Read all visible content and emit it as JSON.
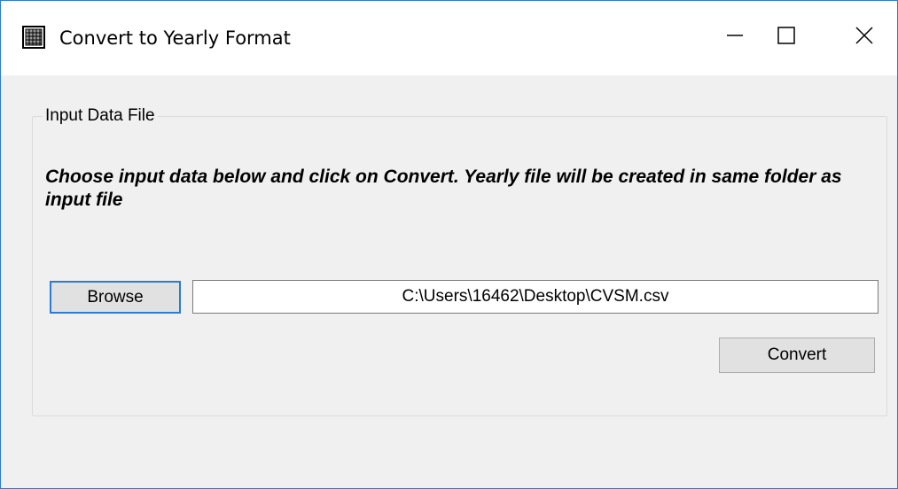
{
  "window": {
    "title": "Convert to Yearly Format",
    "icon": "table-grid-icon",
    "border_color": "#2b7cd3",
    "background": "#f0f0f0"
  },
  "titlebar": {
    "minimize_icon": "minimize-icon",
    "maximize_icon": "maximize-icon",
    "close_icon": "close-icon"
  },
  "group": {
    "label": "Input Data File",
    "instructions": "Choose input data below and click on Convert.  Yearly file will be created in same folder as input file"
  },
  "browse": {
    "label": "Browse"
  },
  "input_file": {
    "value": "C:\\Users\\16462\\Desktop\\CVSM.csv"
  },
  "convert": {
    "label": "Convert"
  }
}
